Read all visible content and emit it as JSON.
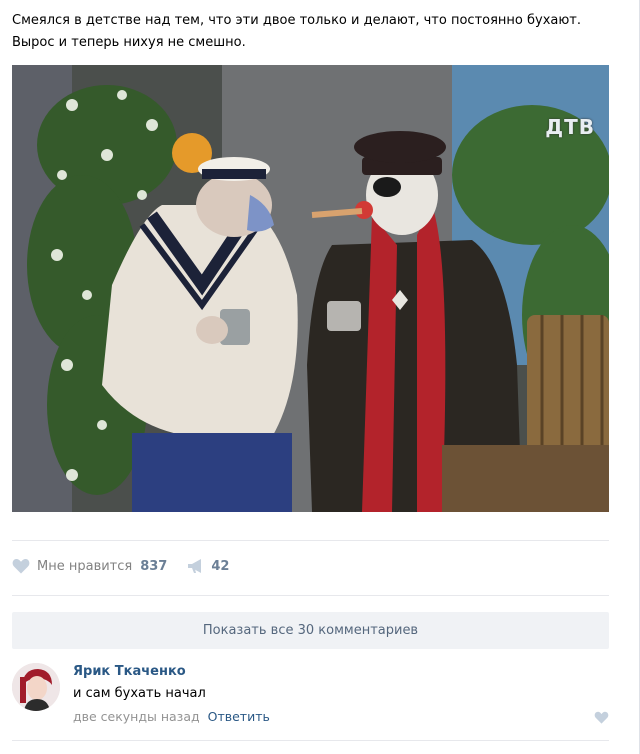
{
  "post": {
    "text_line1": "Смеялся в детстве над тем, что эти двое только и делают, что постоянно бухают.",
    "text_line2": "Вырос и теперь нихуя не смешно.",
    "image": {
      "channel_logo": "ДТВ"
    }
  },
  "actions": {
    "like_label": "Мне нравится",
    "like_count": "837",
    "share_count": "42",
    "like_icon": "heart-icon",
    "share_icon": "megaphone-icon"
  },
  "comments": {
    "show_all_label": "Показать все 30 комментариев",
    "items": [
      {
        "author": "Ярик Ткаченко",
        "text": "и сам бухать начал",
        "time": "две секунды назад",
        "reply_label": "Ответить"
      }
    ]
  },
  "colors": {
    "link": "#2a5885",
    "meta": "#939393",
    "count": "#6b7f96",
    "button_bg": "#f0f2f5",
    "like_icon": "#c4d0dd"
  }
}
